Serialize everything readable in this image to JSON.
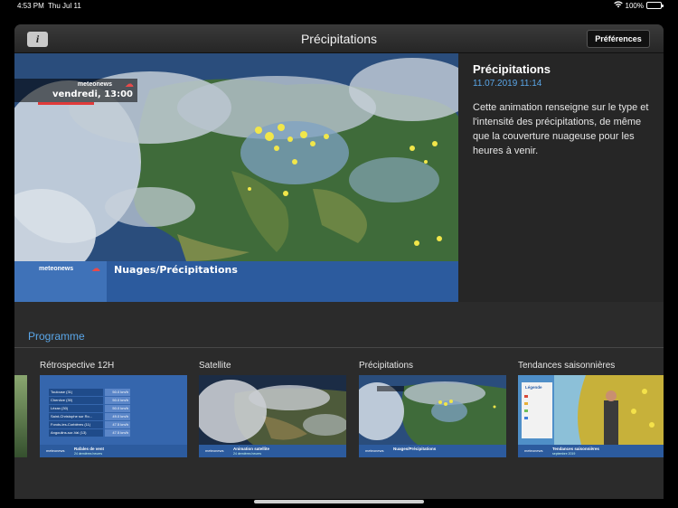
{
  "status": {
    "time": "4:53 PM",
    "date": "Thu Jul 11",
    "battery": "100%"
  },
  "navbar": {
    "title": "Précipitations",
    "info_label": "i",
    "preferences_label": "Préférences"
  },
  "hero": {
    "video": {
      "brand": "meteonews",
      "clock": "vendredi, 13:00",
      "lower_third": "Nuages/Précipitations"
    },
    "title": "Précipitations",
    "date": "11.07.2019 11:14",
    "description": "Cette animation renseigne sur le type et l'intensité des précipitations, de même que la couverture nuageuse pour les heures à venir."
  },
  "programme": {
    "title": "Programme",
    "items": [
      {
        "label": "Rétrospective 12H",
        "strip_title": "Rafales de vent",
        "strip_sub": "24 dernières heures",
        "rows": [
          {
            "place": "Toulouse (31)",
            "value": "50.0 km/h"
          },
          {
            "place": "Chenôve (30)",
            "value": "50.0 km/h"
          },
          {
            "place": "Lézan (30)",
            "value": "50.0 km/h"
          },
          {
            "place": "Saint-Christophe sur Ro...",
            "value": "49.0 km/h"
          },
          {
            "place": "Fonds-les-Corbières (11)",
            "value": "47.5 km/h"
          },
          {
            "place": "Angoulins-sur-Val (13)",
            "value": "47.5 km/h"
          }
        ]
      },
      {
        "label": "Satellite",
        "strip_title": "Animation satellite",
        "strip_sub": "24 dernières heures"
      },
      {
        "label": "Précipitations",
        "strip_title": "Nuages/Précipitations",
        "strip_sub": ""
      },
      {
        "label": "Tendances saisonnières",
        "strip_title": "Tendances saisonnières",
        "strip_sub": "septembre 2019",
        "legend": "Légende"
      }
    ]
  },
  "colors": {
    "accent": "#5aa6e8",
    "background": "#2b2b2b",
    "broadcast_blue": "#2c5b9e",
    "brand_red": "#e03a3a"
  }
}
